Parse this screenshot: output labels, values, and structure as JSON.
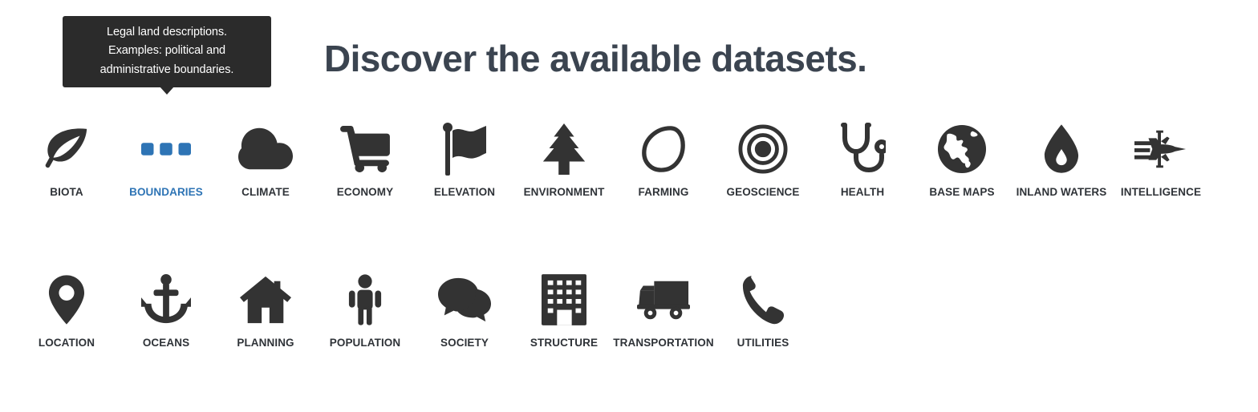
{
  "tooltip": {
    "name": "boundaries-tooltip",
    "lines": [
      "Legal land descriptions.",
      "Examples: political and",
      "administrative boundaries."
    ],
    "background_color": "#2b2b2b",
    "text_color": "#ffffff"
  },
  "header": {
    "title": "Discover the available datasets.",
    "title_color": "#3b4450"
  },
  "colors": {
    "icon_default": "#333333",
    "label_default": "#2f3338",
    "active_blue": "#2e74b5",
    "page_background": "#ffffff"
  },
  "rows": [
    {
      "items": [
        {
          "label": "BIOTA",
          "icon": "leaf-icon",
          "active": false
        },
        {
          "label": "BOUNDARIES",
          "icon": "dots-icon",
          "active": true
        },
        {
          "label": "CLIMATE",
          "icon": "cloud-icon",
          "active": false
        },
        {
          "label": "ECONOMY",
          "icon": "cart-icon",
          "active": false
        },
        {
          "label": "ELEVATION",
          "icon": "flag-icon",
          "active": false
        },
        {
          "label": "ENVIRONMENT",
          "icon": "tree-icon",
          "active": false
        },
        {
          "label": "FARMING",
          "icon": "lemon-icon",
          "active": false
        },
        {
          "label": "GEOSCIENCE",
          "icon": "target-icon",
          "active": false
        },
        {
          "label": "HEALTH",
          "icon": "stethoscope-icon",
          "active": false
        },
        {
          "label": "BASE MAPS",
          "icon": "globe-icon",
          "active": false
        },
        {
          "label": "INLAND WATERS",
          "icon": "droplet-icon",
          "active": false
        },
        {
          "label": "INTELLIGENCE",
          "icon": "jet-icon",
          "active": false
        }
      ]
    },
    {
      "items": [
        {
          "label": "LOCATION",
          "icon": "map-pin-icon",
          "active": false
        },
        {
          "label": "OCEANS",
          "icon": "anchor-icon",
          "active": false
        },
        {
          "label": "PLANNING",
          "icon": "house-icon",
          "active": false
        },
        {
          "label": "POPULATION",
          "icon": "person-icon",
          "active": false
        },
        {
          "label": "SOCIETY",
          "icon": "speech-bubble-icon",
          "active": false
        },
        {
          "label": "STRUCTURE",
          "icon": "building-icon",
          "active": false
        },
        {
          "label": "TRANSPORTATION",
          "icon": "truck-icon",
          "active": false
        },
        {
          "label": "UTILITIES",
          "icon": "phone-icon",
          "active": false
        }
      ]
    }
  ]
}
